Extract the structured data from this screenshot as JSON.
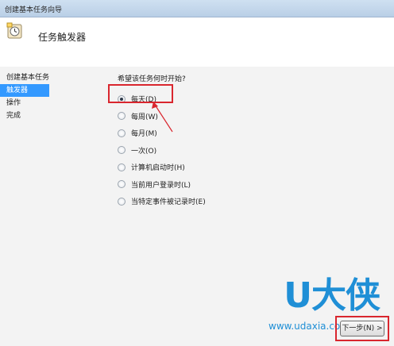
{
  "window": {
    "title": "创建基本任务向导"
  },
  "header": {
    "heading": "任务触发器",
    "icon": "clock-wizard-icon"
  },
  "sidebar": {
    "steps": [
      {
        "label": "创建基本任务",
        "active": false
      },
      {
        "label": "触发器",
        "active": true
      },
      {
        "label": "操作",
        "active": false
      },
      {
        "label": "完成",
        "active": false
      }
    ]
  },
  "main": {
    "prompt": "希望该任务何时开始?",
    "options": [
      {
        "label": "每天(D)",
        "checked": true
      },
      {
        "label": "每周(W)",
        "checked": false
      },
      {
        "label": "每月(M)",
        "checked": false
      },
      {
        "label": "一次(O)",
        "checked": false
      },
      {
        "label": "计算机启动时(H)",
        "checked": false
      },
      {
        "label": "当前用户登录时(L)",
        "checked": false
      },
      {
        "label": "当特定事件被记录时(E)",
        "checked": false
      }
    ]
  },
  "footer": {
    "next_label": "下一步(N) >"
  },
  "watermark": {
    "brand": "U大侠",
    "site": "www.udaxia.com"
  },
  "colors": {
    "selection": "#3399ff",
    "annotation": "#d9262e",
    "watermark": "#1f8fd6"
  }
}
